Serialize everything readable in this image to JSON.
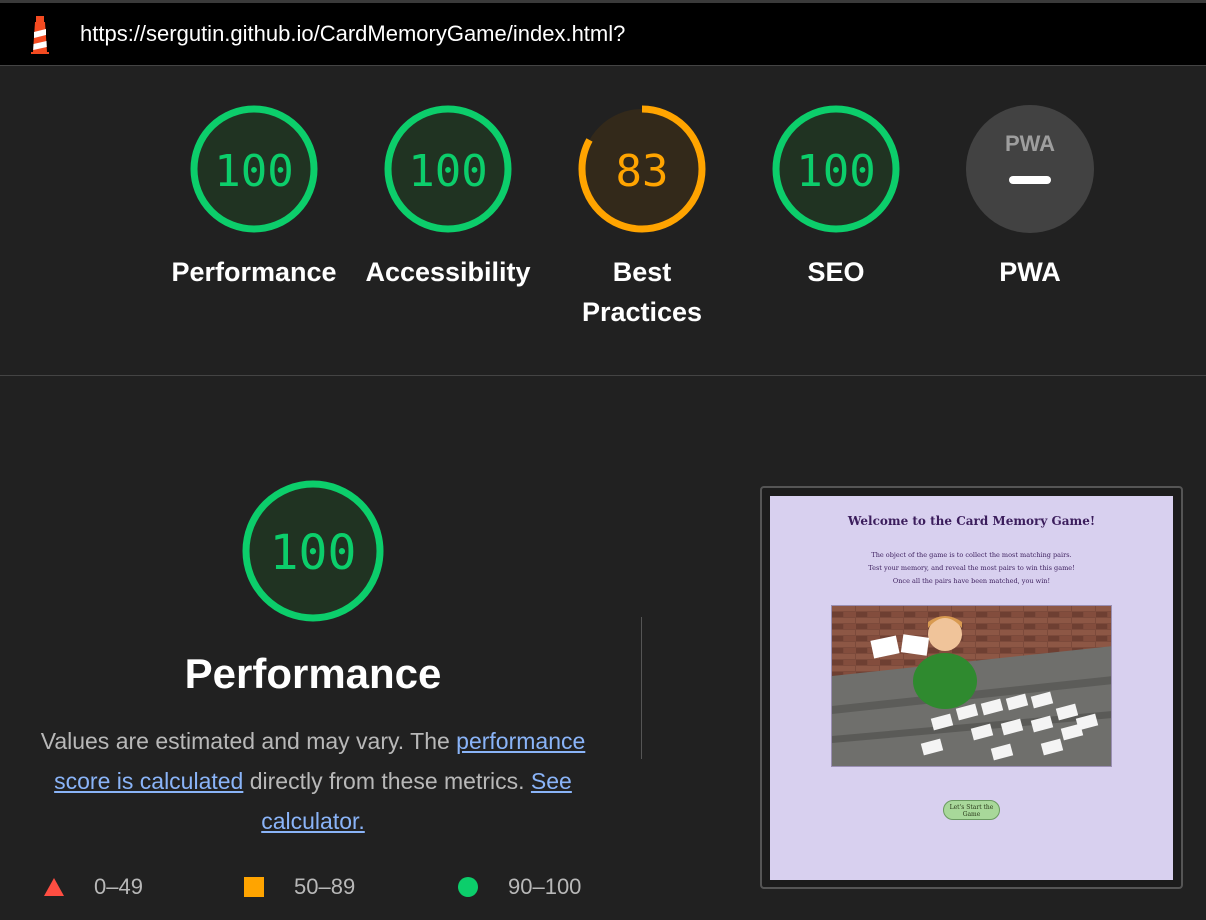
{
  "header": {
    "url": "https://sergutin.github.io/CardMemoryGame/index.html?",
    "logo_icon": "lighthouse-icon"
  },
  "categories": [
    {
      "id": "performance",
      "score": "100",
      "label": "Performance",
      "level": 1.0,
      "color": "#0cce6b"
    },
    {
      "id": "accessibility",
      "score": "100",
      "label": "Accessibility",
      "level": 1.0,
      "color": "#0cce6b"
    },
    {
      "id": "best-practices",
      "score": "83",
      "label_line1": "Best",
      "label_line2": "Practices",
      "level": 0.83,
      "color": "#ffa400"
    },
    {
      "id": "seo",
      "score": "100",
      "label": "SEO",
      "level": 1.0,
      "color": "#0cce6b"
    },
    {
      "id": "pwa",
      "badge": "PWA",
      "label": "PWA",
      "icon": "pwa-dash-icon"
    }
  ],
  "performance_section": {
    "score": "100",
    "title": "Performance",
    "desc_prefix": "Values are estimated and may vary. The ",
    "link1": "performance score is calculated",
    "desc_middle": " directly from these metrics. ",
    "link2": "See calculator.",
    "legend": [
      {
        "range": "0–49",
        "color": "#ff4e42",
        "icon": "triangle-fail-icon"
      },
      {
        "range": "50–89",
        "color": "#ffa400",
        "icon": "square-average-icon"
      },
      {
        "range": "90–100",
        "color": "#0cce6b",
        "icon": "circle-pass-icon"
      }
    ]
  },
  "final_screenshot": {
    "title": "Welcome to the Card Memory Game!",
    "line1": "The object of the game is to collect the most matching pairs.",
    "line2": "Test your memory, and reveal the most pairs to win this game!",
    "line3": "Once all the pairs have been matched, you win!",
    "button": "Let's Start the Game"
  }
}
